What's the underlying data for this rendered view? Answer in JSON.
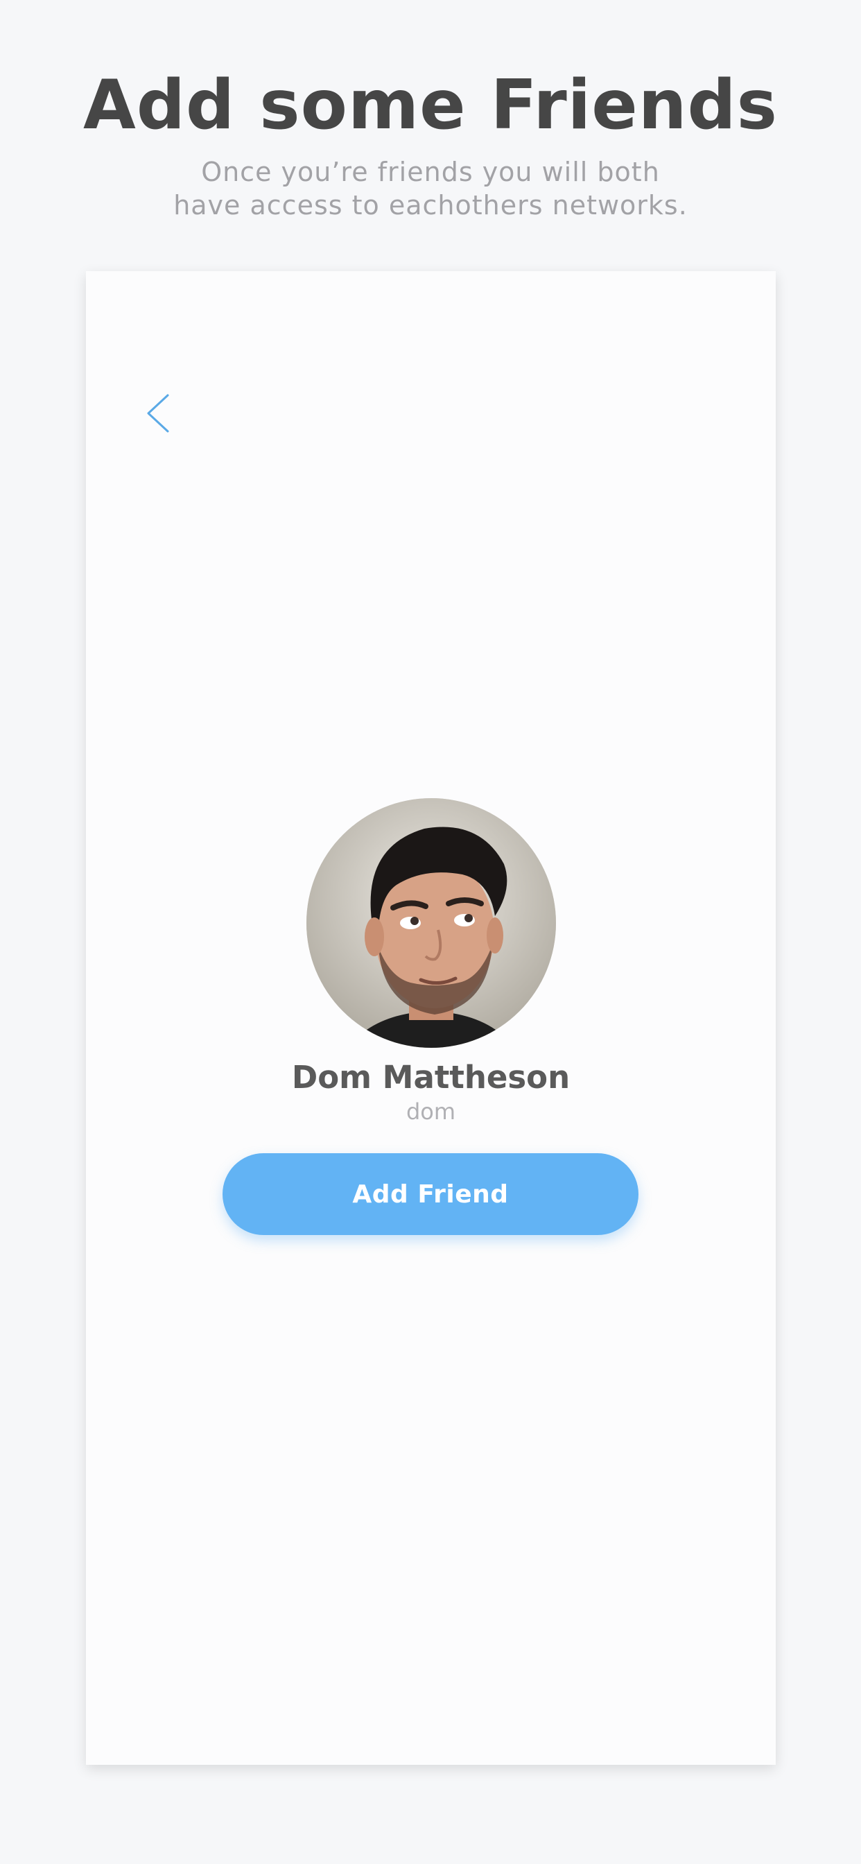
{
  "promo": {
    "title": "Add some Friends",
    "subtitle_line1": "Once you’re friends you will both",
    "subtitle_line2": "have access to eachothers networks."
  },
  "screen": {
    "back_icon": "chevron-left-icon",
    "profile": {
      "name": "Dom Mattheson",
      "username": "dom"
    },
    "add_friend_label": "Add Friend"
  },
  "colors": {
    "background": "#f6f7f9",
    "card": "#fcfcfd",
    "title": "#464646",
    "subtitle": "#a2a2a6",
    "accent": "#62b3f4",
    "back_icon": "#5aa9e6"
  }
}
